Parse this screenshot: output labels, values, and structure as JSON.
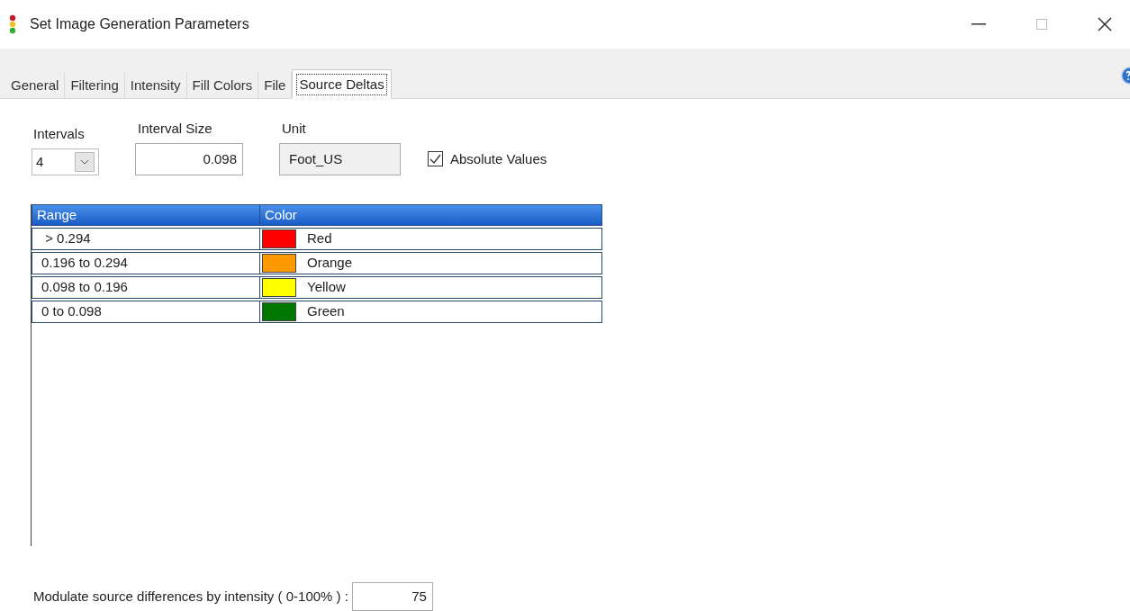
{
  "window": {
    "title": "Set Image Generation Parameters"
  },
  "tabs": [
    {
      "label": "General",
      "selected": false
    },
    {
      "label": "Filtering",
      "selected": false
    },
    {
      "label": "Intensity",
      "selected": false
    },
    {
      "label": "Fill Colors",
      "selected": false
    },
    {
      "label": "File",
      "selected": false
    },
    {
      "label": "Source Deltas",
      "selected": true
    }
  ],
  "intervals": {
    "label": "Intervals",
    "value": "4"
  },
  "interval_size": {
    "label": "Interval Size",
    "value": "0.098"
  },
  "unit": {
    "label": "Unit",
    "value": "Foot_US"
  },
  "absolute_values": {
    "label": "Absolute Values",
    "checked": true
  },
  "table": {
    "columns": [
      "Range",
      "Color"
    ],
    "rows": [
      {
        "range": " > 0.294",
        "color": "#ff0000",
        "name": "Red"
      },
      {
        "range": "0.196 to 0.294",
        "color": "#ff9900",
        "name": "Orange"
      },
      {
        "range": "0.098 to 0.196",
        "color": "#ffff00",
        "name": "Yellow"
      },
      {
        "range": "0 to 0.098",
        "color": "#007700",
        "name": "Green"
      }
    ]
  },
  "modulate": {
    "label": "Modulate source differences by intensity ( 0-100% ) :",
    "value": "75"
  }
}
